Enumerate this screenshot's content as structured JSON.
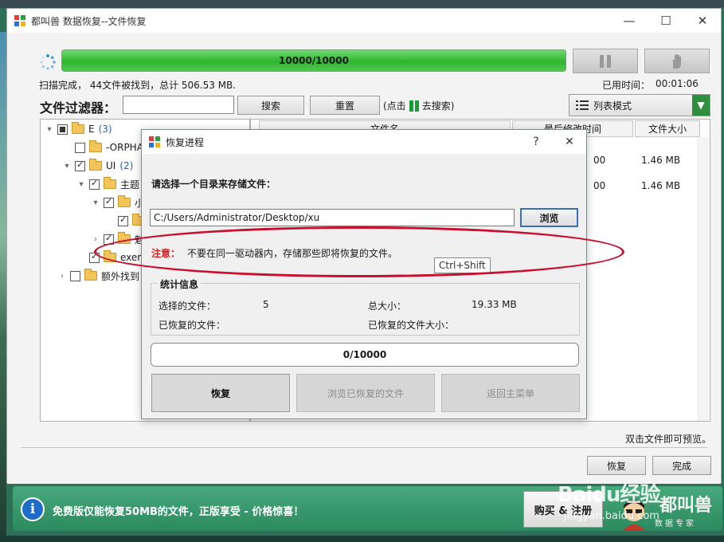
{
  "window": {
    "title": "都叫兽 数据恢复--文件恢复",
    "minimize_glyph": "—",
    "maximize_glyph": "☐",
    "close_glyph": "✕"
  },
  "scan": {
    "progress_text": "10000/10000",
    "progress_fraction": 1.0,
    "status": "扫描完成， 44文件被找到，总计 506.53 MB.",
    "elapsed_label": "已用时间：",
    "elapsed_value": "00:01:06"
  },
  "filter": {
    "label": "文件过滤器：",
    "input_value": "",
    "search_button": "搜索",
    "reset_button": "重置",
    "hint_prefix": "(点击",
    "hint_suffix": "去搜索)",
    "view_mode": "列表模式",
    "view_mode_arrow": "▼"
  },
  "tree": [
    {
      "chevron": "▾",
      "checkbox": "partial",
      "label": "E",
      "count": "(3)"
    },
    {
      "chevron": "",
      "checkbox": "unchecked",
      "label": "-ORPHA",
      "count": ""
    },
    {
      "chevron": "▾",
      "checkbox": "checked",
      "label": "UI",
      "count": "(2)"
    },
    {
      "chevron": "▾",
      "checkbox": "checked",
      "label": "主题",
      "count": ""
    },
    {
      "chevron": "▾",
      "checkbox": "checked",
      "label": "小",
      "count": ""
    },
    {
      "chevron": "",
      "checkbox": "checked",
      "label": "",
      "count": ""
    },
    {
      "chevron": "›",
      "checkbox": "checked",
      "label": "魅",
      "count": ""
    },
    {
      "chevron": "",
      "checkbox": "checked",
      "label": "exer",
      "count": ""
    },
    {
      "chevron": "›",
      "checkbox": "unchecked",
      "label": "额外找到",
      "count": ""
    }
  ],
  "list": {
    "columns": [
      "文件名",
      "最后修改时间",
      "文件大小"
    ],
    "rows": [
      {
        "time_fragment": "00",
        "size": "1.46 MB"
      },
      {
        "time_fragment": "00",
        "size": "1.46 MB"
      }
    ],
    "preview_hint": "双击文件即可预览。"
  },
  "footer": {
    "restore_button": "恢复",
    "finish_button": "完成"
  },
  "dialog": {
    "title": "恢复进程",
    "help_glyph": "?",
    "close_glyph": "✕",
    "choose_dir_label": "请选择一个目录来存储文件：",
    "path_value": "C:/Users/Administrator/Desktop/xu",
    "browse_button": "浏览",
    "note_label": "注意：",
    "note_text": "不要在同一驱动器内，存储那些即将恢复的文件。",
    "tooltip": "Ctrl+Shift",
    "stats_title": "统计信息",
    "selected_files_label": "选择的文件：",
    "selected_files_value": "5",
    "total_size_label": "总大小：",
    "total_size_value": "19.33 MB",
    "recovered_files_label": "已恢复的文件：",
    "recovered_size_label": "已恢复的文件大小：",
    "progress_text": "0/10000",
    "recover_button": "恢复",
    "browse_recovered_button": "浏览已恢复的文件",
    "back_main_button": "返回主菜单"
  },
  "promo": {
    "info_glyph": "i",
    "text": "免费版仅能恢复50MB的文件，正版享受 - 价格惊喜！",
    "buy_button": "购买 & 注册",
    "brand_title": "都叫兽",
    "brand_sub": "数据专家"
  },
  "watermark": {
    "logo_text": "Bai",
    "logo_paw": "du",
    "logo_cn": "经验",
    "url": "jingyan.baidu.com"
  },
  "colors": {
    "accent_green": "#2fb52f",
    "annotation_red": "#c8102e",
    "note_red": "#d21f1f",
    "promo_green": "#2b8a5e"
  }
}
